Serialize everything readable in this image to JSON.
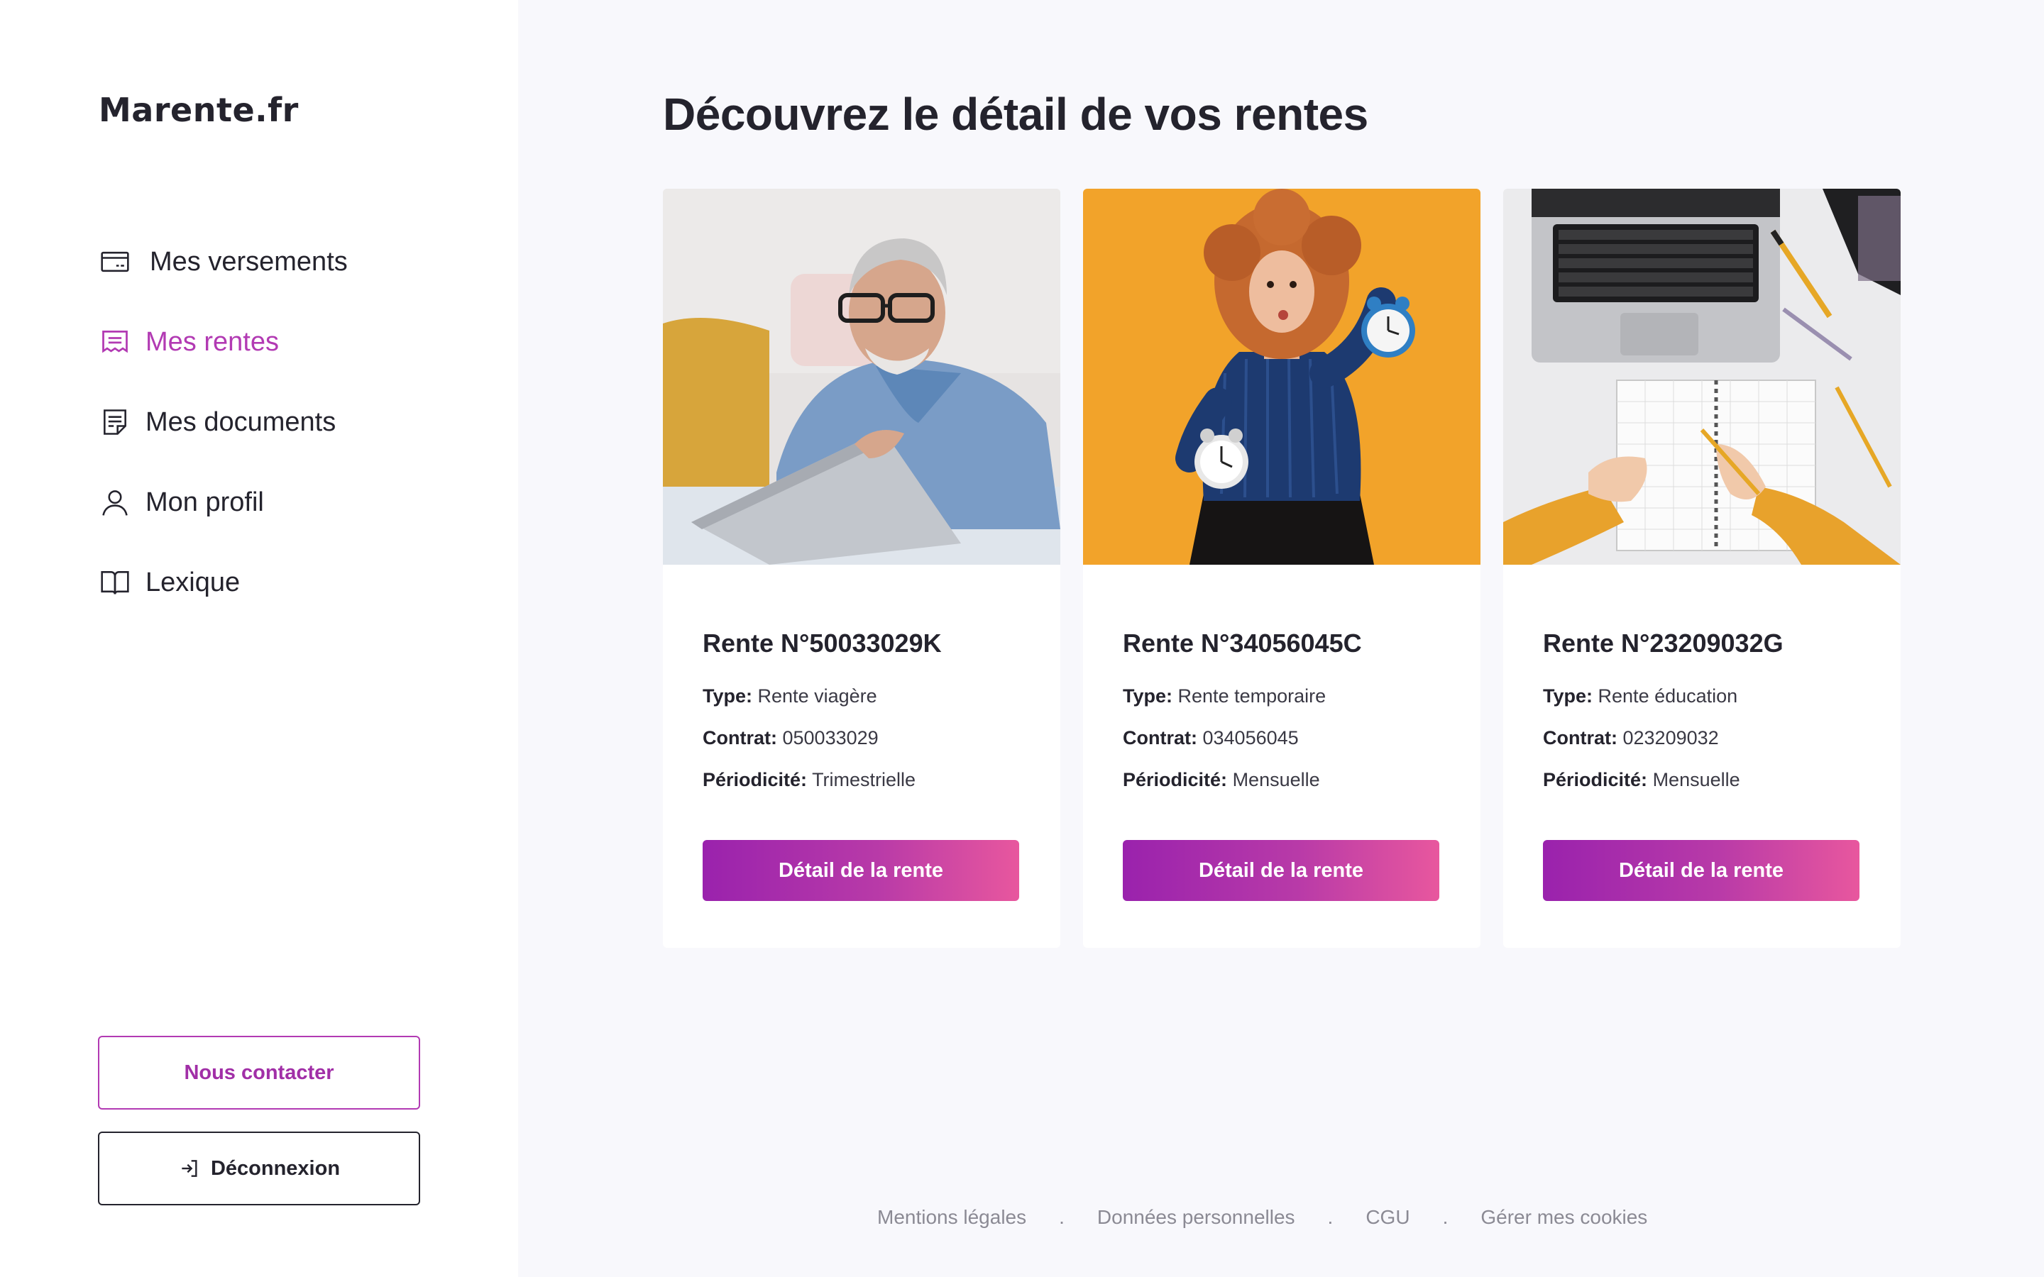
{
  "sidebar": {
    "brand": "Marente.fr",
    "nav": [
      {
        "label": "Mes versements",
        "icon": "card-icon"
      },
      {
        "label": "Mes rentes",
        "icon": "receipt-icon",
        "active": true
      },
      {
        "label": "Mes documents",
        "icon": "document-icon"
      },
      {
        "label": "Mon profil",
        "icon": "user-icon"
      },
      {
        "label": "Lexique",
        "icon": "book-icon"
      }
    ],
    "contact_label": "Nous contacter",
    "logout_label": "Déconnexion"
  },
  "main": {
    "title": "Découvrez le détail de vos rentes",
    "type_label": "Type:",
    "contract_label": "Contrat:",
    "periodicity_label": "Périodicité:",
    "button_label": "Détail de la rente",
    "cards": [
      {
        "title": "Rente N°50033029K",
        "type": "Rente viagère",
        "contract": "050033029",
        "periodicity": "Trimestrielle",
        "image": "senior-man-laptop-photo"
      },
      {
        "title": "Rente N°34056045C",
        "type": "Rente temporaire",
        "contract": "034056045",
        "periodicity": "Mensuelle",
        "image": "woman-alarm-clocks-photo"
      },
      {
        "title": "Rente N°23209032G",
        "type": "Rente éducation",
        "contract": "023209032",
        "periodicity": "Mensuelle",
        "image": "desk-notebook-laptop-photo"
      }
    ]
  },
  "footer": {
    "links": [
      "Mentions légales",
      "Données personnelles",
      "CGU",
      "Gérer mes cookies"
    ],
    "separator": "."
  },
  "colors": {
    "accent": "#b23ab3",
    "button_gradient_start": "#9a22ad",
    "button_gradient_end": "#e8579e",
    "background": "#f8f8fc",
    "text": "#24232d"
  }
}
